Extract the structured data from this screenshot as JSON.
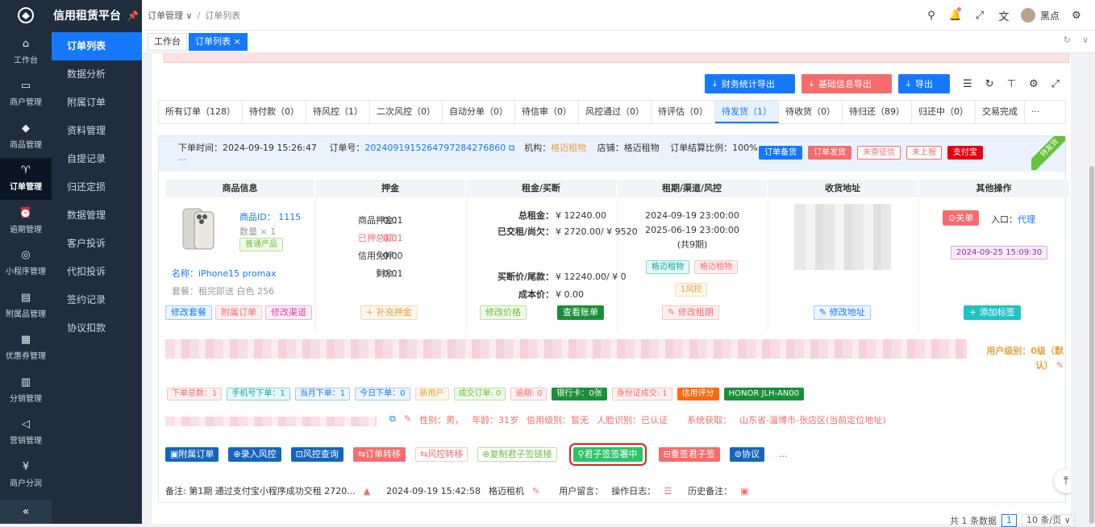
{
  "app": {
    "title": "信用租赁平台"
  },
  "rail": [
    {
      "label": "工作台",
      "icon": "⌂"
    },
    {
      "label": "商户管理",
      "icon": "▭"
    },
    {
      "label": "商品管理",
      "icon": "◆"
    },
    {
      "label": "订单管理",
      "icon": "♈"
    },
    {
      "label": "逾期管理",
      "icon": "⏰"
    },
    {
      "label": "小程序管理",
      "icon": "◎"
    },
    {
      "label": "附属品管理",
      "icon": "▤"
    },
    {
      "label": "优惠券管理",
      "icon": "▦"
    },
    {
      "label": "分销管理",
      "icon": "▥"
    },
    {
      "label": "营销管理",
      "icon": "◁"
    },
    {
      "label": "商户分润",
      "icon": "¥"
    }
  ],
  "submenu": [
    "订单列表",
    "数据分析",
    "附属订单",
    "资料管理",
    "自提记录",
    "归还定损",
    "数据管理",
    "客户投诉",
    "代扣投诉",
    "签约记录",
    "协议扣款"
  ],
  "breadcrumb": {
    "first": "订单管理",
    "second": "订单列表"
  },
  "user": {
    "name": "黑点"
  },
  "pagetabs": {
    "home": "工作台",
    "current": "订单列表"
  },
  "actions": {
    "finance": "财务统计导出",
    "basic": "基础信息导出",
    "export": "导出"
  },
  "order_tabs": [
    "所有订单（128）",
    "待付款（0）",
    "待风控（1）",
    "二次风控（0）",
    "自动分单（0）",
    "待信审（0）",
    "风控通过（0）",
    "待评估（0）",
    "待发货（1）",
    "待收货（0）",
    "待归还（89）",
    "归还中（0）",
    "交易完成"
  ],
  "order": {
    "time_label": "下单时间：2024-09-19 15:26:47",
    "no_label": "订单号：",
    "no": "20240919152647972842768​60",
    "org_label": "机构：",
    "org": "格迈租物",
    "shop": "店铺：格迈租物",
    "ratio": "订单结算比例：100%",
    "more": "...",
    "corner": "待发货",
    "tags": [
      "订单备货",
      "订单发货",
      "未查征信",
      "未上报",
      "支付宝"
    ],
    "columns": [
      "商品信息",
      "押金",
      "租金/买断",
      "租期/渠道/风控",
      "收货地址",
      "其他操作"
    ],
    "product": {
      "id": "商品ID：  1115",
      "qty": "数量 × 1",
      "type": "普通产品",
      "name": "名称：iPhone15 promax",
      "plan": "套餐：租完即送 白色 256"
    },
    "deposit": {
      "l1": "商品押金：",
      "v1": "0.01",
      "l2": "已押总额：",
      "v2": "0.01",
      "l3": "信用免押：",
      "v3": "0.00",
      "l4": "剩余：",
      "v4": "0.01"
    },
    "rent": {
      "l1": "总租金：",
      "v1": "¥ 12240.00",
      "l2": "已交租/尚欠：",
      "v2": "¥ 2720.00/ ¥ 9520",
      "l3": "买断价/尾款：",
      "v3": "¥ 12240.00/ ¥ 0",
      "l4": "成本价：",
      "v4": "¥ 0.00"
    },
    "term": {
      "start": "2024-09-19 23:00:00",
      "end": "2025-06-19 23:00:00",
      "periods": "(共9期)",
      "ch1": "格迈租物",
      "ch2": "格迈租物",
      "risk": "1风控"
    },
    "ops": {
      "close": "⊙关单",
      "entry": "入口：",
      "agent": "代理",
      "date": "2024-09-25 15:09:30"
    },
    "col_buttons": {
      "modify_plan": "修改套餐",
      "sub_order": "附属订单",
      "modify_channel": "修改渠道",
      "add_deposit": "+ 补充押金",
      "modify_price": "修改价格",
      "view_bill": "查看账单",
      "modify_term": "修改租期",
      "modify_addr": "修改地址",
      "add_tag": "+ 添加标签"
    },
    "user_level": "用户级别：0级（默认）",
    "info_tags": [
      "下单总数：1",
      "手机号下单：1",
      "当月下单：1",
      "今日下单：0",
      "新用户",
      "成交订单: 0",
      "逾期: 0",
      "银行卡：0张",
      "身份证成交: 1",
      "信用评分",
      "HONOR JLH-AN00"
    ],
    "profile": {
      "gender": "性别：男，",
      "age": "年龄：31岁",
      "credit": "信用级别：暂无",
      "face": "人脸识别：已认证",
      "sys": "系统获取：",
      "loc": "山东省-淄博市-张店区(当前定位地址)"
    },
    "op_buttons": [
      "▣附属订单",
      "⊕录入风控",
      "⊡风控查询",
      "⇆订单转移",
      "⇆风控转移",
      "⊕复制君子签链接",
      "⚲君子签签署中",
      "⊟重签君子签",
      "⊜协议",
      "..."
    ],
    "remark": "备注: 第1期 通过支付宝小程序成功交租 2720...",
    "remark_time": "2024-09-19 15:42:58",
    "remark_by": "格迈租机",
    "msg": "用户留言：",
    "log": "操作日志：",
    "hist": "历史备注："
  },
  "pager": {
    "total": "共 1 条数据",
    "page": "1",
    "size": "10 条/页"
  }
}
